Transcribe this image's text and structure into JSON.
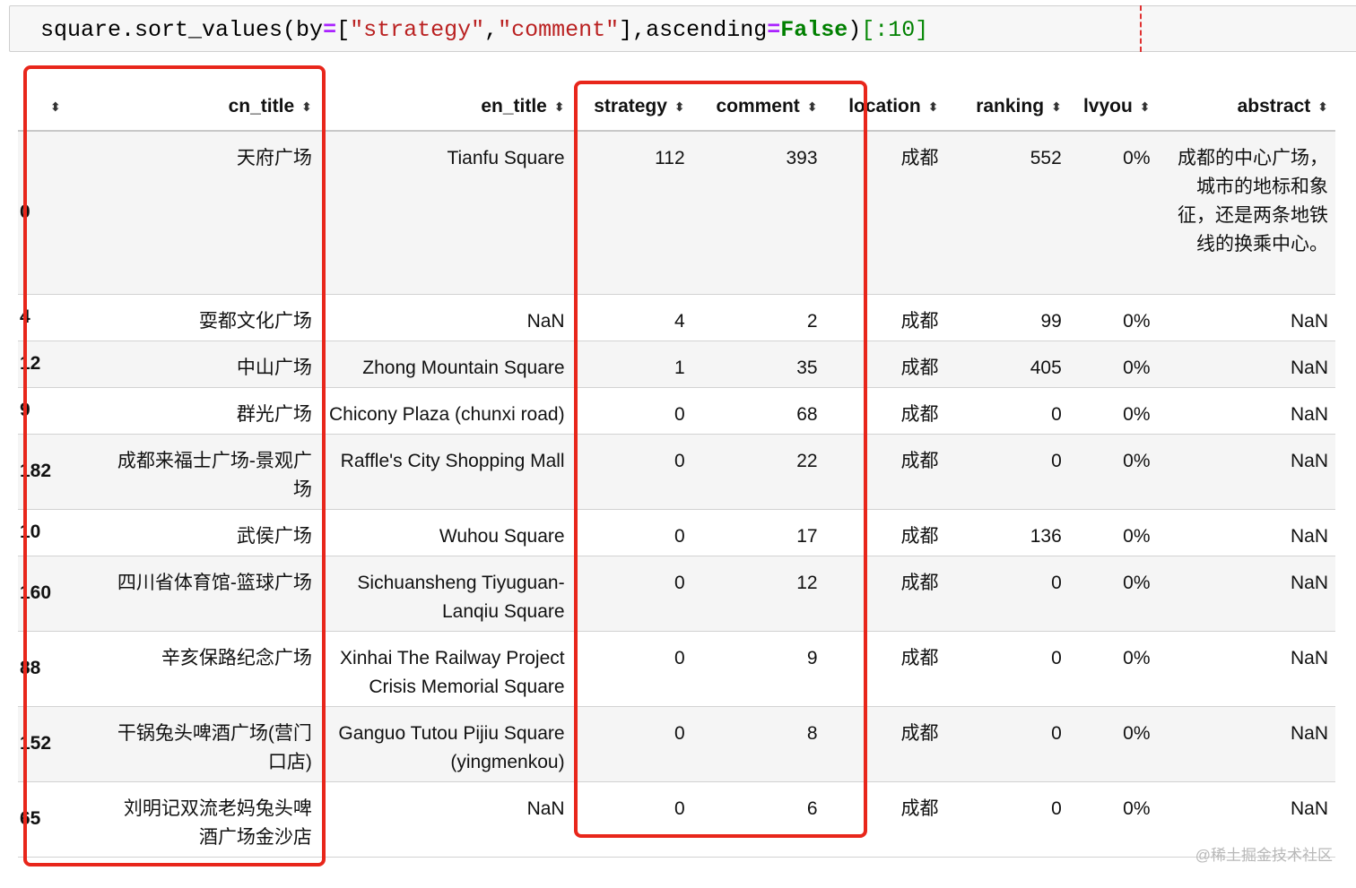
{
  "code": {
    "prefix": "square.sort_values(by",
    "op1": "=",
    "bracket_open": "[",
    "str1": "\"strategy\"",
    "comma1": ",",
    "str2": "\"comment\"",
    "bracket_close": "],ascending",
    "op2": "=",
    "kw_false": "False",
    "close_paren": ")",
    "slice_open": "[:",
    "slice_num": "10",
    "slice_close": "]"
  },
  "table": {
    "headers": {
      "index": "",
      "cn_title": "cn_title",
      "en_title": "en_title",
      "strategy": "strategy",
      "comment": "comment",
      "location": "location",
      "ranking": "ranking",
      "lvyou": "lvyou",
      "abstract": "abstract"
    },
    "sort_glyph": "⬍",
    "rows": [
      {
        "index": "0",
        "cn_title": "天府广场",
        "en_title": "Tianfu Square",
        "strategy": "112",
        "comment": "393",
        "location": "成都",
        "ranking": "552",
        "lvyou": "0%",
        "abstract": "成都的中心广场，城市的地标和象征，还是两条地铁线的换乘中心。"
      },
      {
        "index": "4",
        "cn_title": "耍都文化广场",
        "en_title": "NaN",
        "strategy": "4",
        "comment": "2",
        "location": "成都",
        "ranking": "99",
        "lvyou": "0%",
        "abstract": "NaN"
      },
      {
        "index": "12",
        "cn_title": "中山广场",
        "en_title": "Zhong Mountain Square",
        "strategy": "1",
        "comment": "35",
        "location": "成都",
        "ranking": "405",
        "lvyou": "0%",
        "abstract": "NaN"
      },
      {
        "index": "9",
        "cn_title": "群光广场",
        "en_title": "Chicony Plaza (chunxi road)",
        "strategy": "0",
        "comment": "68",
        "location": "成都",
        "ranking": "0",
        "lvyou": "0%",
        "abstract": "NaN"
      },
      {
        "index": "182",
        "cn_title": "成都来福士广场-景观广场",
        "en_title": "Raffle's City Shopping Mall",
        "strategy": "0",
        "comment": "22",
        "location": "成都",
        "ranking": "0",
        "lvyou": "0%",
        "abstract": "NaN"
      },
      {
        "index": "10",
        "cn_title": "武侯广场",
        "en_title": "Wuhou Square",
        "strategy": "0",
        "comment": "17",
        "location": "成都",
        "ranking": "136",
        "lvyou": "0%",
        "abstract": "NaN"
      },
      {
        "index": "160",
        "cn_title": "四川省体育馆-篮球广场",
        "en_title": "Sichuansheng Tiyuguan-Lanqiu Square",
        "strategy": "0",
        "comment": "12",
        "location": "成都",
        "ranking": "0",
        "lvyou": "0%",
        "abstract": "NaN"
      },
      {
        "index": "88",
        "cn_title": "辛亥保路纪念广场",
        "en_title": "Xinhai The Railway Project Crisis Memorial Square",
        "strategy": "0",
        "comment": "9",
        "location": "成都",
        "ranking": "0",
        "lvyou": "0%",
        "abstract": "NaN"
      },
      {
        "index": "152",
        "cn_title": "干锅兔头啤酒广场(营门口店)",
        "en_title": "Ganguo Tutou Pijiu Square (yingmenkou)",
        "strategy": "0",
        "comment": "8",
        "location": "成都",
        "ranking": "0",
        "lvyou": "0%",
        "abstract": "NaN"
      },
      {
        "index": "65",
        "cn_title": "刘明记双流老妈兔头啤酒广场金沙店",
        "en_title": "NaN",
        "strategy": "0",
        "comment": "6",
        "location": "成都",
        "ranking": "0",
        "lvyou": "0%",
        "abstract": "NaN"
      }
    ]
  },
  "watermark": "@稀土掘金技术社区",
  "colors": {
    "highlight": "#e8261b",
    "string": "#ba2121",
    "keyword": "#008000",
    "operator": "#aa22ff"
  }
}
